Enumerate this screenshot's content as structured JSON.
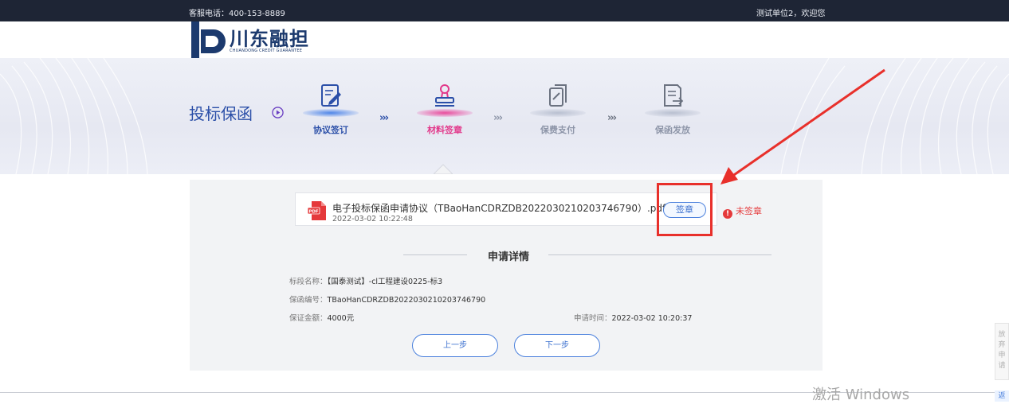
{
  "topbar": {
    "hotline": "客服电话：400-153-8889",
    "welcome": "测试单位2，欢迎您"
  },
  "logo": {
    "name_cn": "川东融担",
    "name_en": "CHUANDONG CREDIT GUARANTEE"
  },
  "banner": {
    "title": "投标保函",
    "steps": [
      {
        "label": "协议签订",
        "icon": "document-edit-icon",
        "active": false
      },
      {
        "label": "材料签章",
        "icon": "seal-stamp-icon",
        "active": true
      },
      {
        "label": "保费支付",
        "icon": "payment-icon",
        "active": false
      },
      {
        "label": "保函发放",
        "icon": "document-issue-icon",
        "active": false
      }
    ],
    "separator": "›››"
  },
  "file": {
    "name": "电子投标保函申请协议（TBaoHanCDRZDB20220302102037467 90）.pdf",
    "date": "2022-03-02 10:22:48",
    "sign_label": "签章",
    "status": "未签章"
  },
  "details": {
    "title": "申请详情",
    "section_name_key": "标段名称：",
    "section_name_val": "【国泰测试】-cl工程建设0225-标3",
    "guarantee_no_key": "保函编号：",
    "guarantee_no_val": "TBaoHanCDRZDB2022030210203746790",
    "deposit_key": "保证金额：",
    "deposit_val": "4000元",
    "apply_time_key": "申请时间：",
    "apply_time_val": "2022-03-02 10:20:37"
  },
  "buttons": {
    "prev": "上一步",
    "next": "下一步"
  },
  "side": {
    "abandon": "放弃申请",
    "back": "返"
  },
  "watermark": "激活 Windows",
  "colors": {
    "brand_blue": "#2b4fa8",
    "active_pink": "#e2388a",
    "alert_red": "#e5393b",
    "topbar": "#1e2535"
  }
}
